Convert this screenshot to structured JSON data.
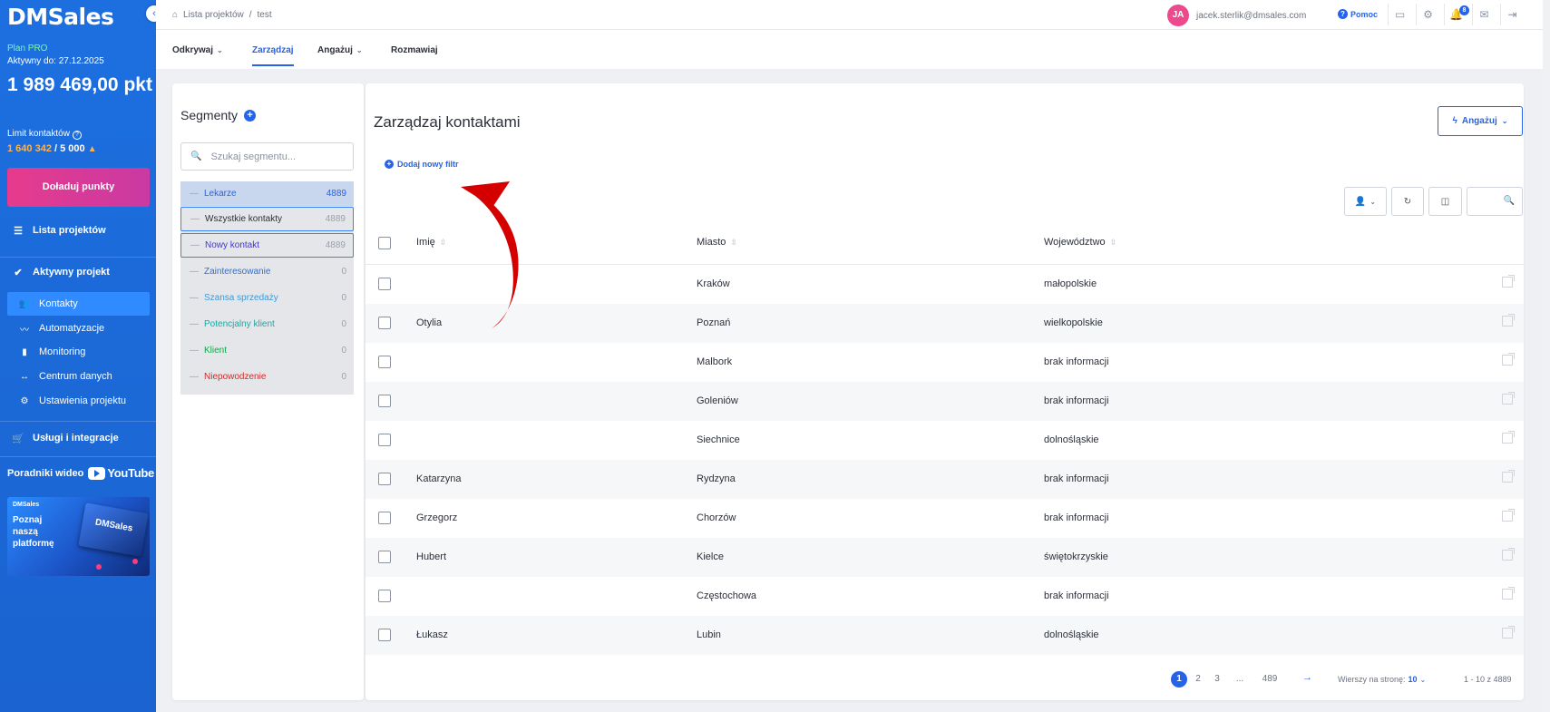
{
  "sidebar": {
    "logo": "DMSales",
    "plan": "Plan PRO",
    "active_until": "Aktywny do: 27.12.2025",
    "points": "1 989 469,00 pkt",
    "limit_label": "Limit kontaktów",
    "limit_used": "1 640 342",
    "limit_total": "/ 5 000",
    "topup_label": "Doładuj punkty",
    "projects_label": "Lista projektów",
    "active_project_label": "Aktywny projekt",
    "sub_items": [
      {
        "label": "Kontakty",
        "icon": "users-icon"
      },
      {
        "label": "Automatyzacje",
        "icon": "automation-icon"
      },
      {
        "label": "Monitoring",
        "icon": "bar-chart-icon"
      },
      {
        "label": "Centrum danych",
        "icon": "arrows-icon"
      },
      {
        "label": "Ustawienia projektu",
        "icon": "gear-icon"
      }
    ],
    "services_label": "Usługi i integracje",
    "video_label": "Poradniki wideo",
    "youtube_label": "YouTube",
    "promo_logo": "DMSales",
    "promo_text": "Poznaj naszą platformę",
    "promo_card_text": "DMSales"
  },
  "topbar": {
    "breadcrumb_root": "Lista projektów",
    "breadcrumb_current": "test",
    "avatar_initials": "JA",
    "user_email": "jacek.sterlik@dmsales.com",
    "help_label": "Pomoc",
    "notifications_count": "8"
  },
  "tabs": [
    {
      "label": "Odkrywaj",
      "has_menu": true
    },
    {
      "label": "Zarządzaj",
      "has_menu": false
    },
    {
      "label": "Angażuj",
      "has_menu": true
    },
    {
      "label": "Rozmawiaj",
      "has_menu": false
    }
  ],
  "segments": {
    "title": "Segmenty",
    "search_placeholder": "Szukaj segmentu...",
    "items": [
      {
        "label": "Lekarze",
        "count": "4889",
        "color": "#2563eb"
      },
      {
        "label": "Wszystkie kontakty",
        "count": "4889",
        "color": "#2b2f3a"
      },
      {
        "label": "Nowy kontakt",
        "count": "4889",
        "color": "#4338ca"
      },
      {
        "label": "Zainteresowanie",
        "count": "0",
        "color": "#2f6fd6"
      },
      {
        "label": "Szansa sprzedaży",
        "count": "0",
        "color": "#3b9bd6"
      },
      {
        "label": "Potencjalny klient",
        "count": "0",
        "color": "#1ea7a0"
      },
      {
        "label": "Klient",
        "count": "0",
        "color": "#16a34a"
      },
      {
        "label": "Niepowodzenie",
        "count": "0",
        "color": "#dc2626"
      }
    ]
  },
  "main": {
    "title": "Zarządzaj kontaktami",
    "engage_label": "Angażuj",
    "add_filter_label": "Dodaj nowy filtr",
    "columns": [
      "Imię",
      "Miasto",
      "Województwo"
    ],
    "rows": [
      {
        "name": "",
        "city": "Kraków",
        "region": "małopolskie"
      },
      {
        "name": "Otylia",
        "city": "Poznań",
        "region": "wielkopolskie"
      },
      {
        "name": "",
        "city": "Malbork",
        "region": "brak informacji"
      },
      {
        "name": "",
        "city": "Goleniów",
        "region": "brak informacji"
      },
      {
        "name": "",
        "city": "Siechnice",
        "region": "dolnośląskie"
      },
      {
        "name": "Katarzyna",
        "city": "Rydzyna",
        "region": "brak informacji"
      },
      {
        "name": "Grzegorz",
        "city": "Chorzów",
        "region": "brak informacji"
      },
      {
        "name": "Hubert",
        "city": "Kielce",
        "region": "świętokrzyskie"
      },
      {
        "name": "",
        "city": "Częstochowa",
        "region": "brak informacji"
      },
      {
        "name": "Łukasz",
        "city": "Lubin",
        "region": "dolnośląskie"
      }
    ],
    "pagination": {
      "pages": [
        "1",
        "2",
        "3",
        "...",
        "489"
      ],
      "current": "1",
      "rows_per_page_label": "Wierszy na stronę:",
      "rows_per_page": "10",
      "range": "1 - 10 z 4889"
    }
  },
  "colors": {
    "accent": "#2563eb",
    "sidebar": "#1a63d0",
    "annotation_arrow": "#d40000"
  }
}
